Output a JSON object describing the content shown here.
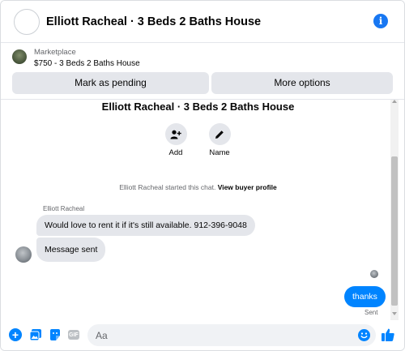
{
  "header": {
    "title": "Elliott Racheal · 3 Beds 2 Baths House",
    "info_icon": "i"
  },
  "marketplace": {
    "label": "Marketplace",
    "item": "$750 - 3 Beds 2 Baths House",
    "mark_pending_label": "Mark as pending",
    "more_options_label": "More options"
  },
  "chat": {
    "title": "Elliott Racheal · 3 Beds 2 Baths House",
    "actions": [
      {
        "label": "Add",
        "icon": "add-person-icon"
      },
      {
        "label": "Name",
        "icon": "pencil-icon"
      }
    ],
    "started_text": "Elliott Racheal started this chat.",
    "view_profile_link": "View buyer profile",
    "sender_name": "Elliott Racheal",
    "incoming": [
      "Would love to rent it if it's still available. 912-396-9048",
      "Message sent"
    ],
    "outgoing": "thanks",
    "status": "Sent"
  },
  "composer": {
    "placeholder": "Aa",
    "gif_label": "GIF"
  },
  "colors": {
    "accent": "#0084ff",
    "info_blue": "#1877f2",
    "bubble_gray": "#e4e6eb",
    "muted_text": "#65676b"
  }
}
